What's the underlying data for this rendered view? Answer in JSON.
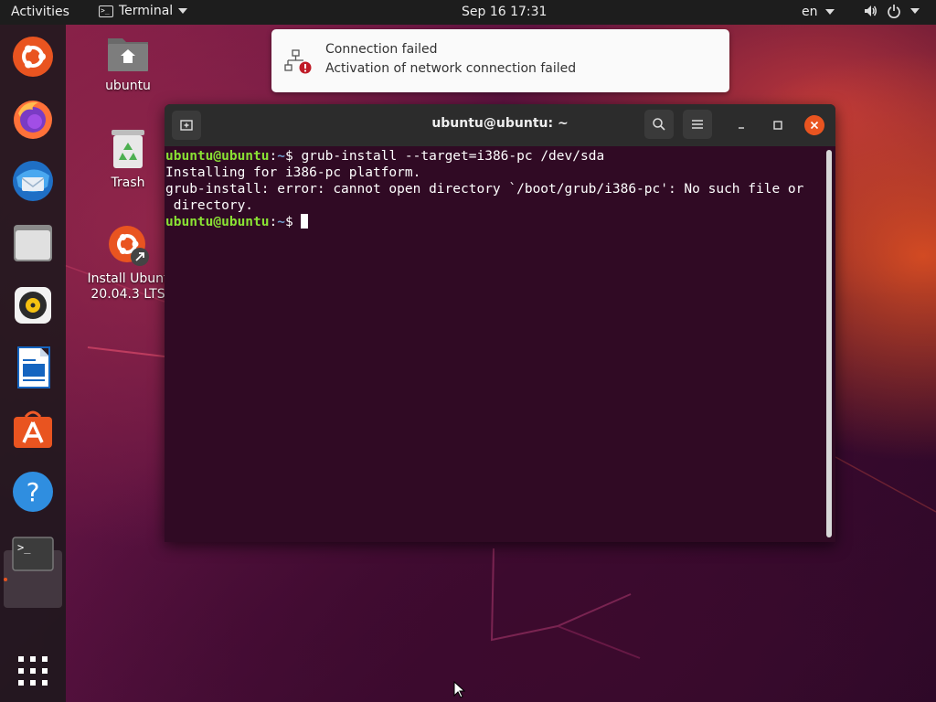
{
  "topbar": {
    "activities": "Activities",
    "app_name": "Terminal",
    "app_icon_glyph": ">_",
    "clock": "Sep 16  17:31",
    "lang": "en",
    "icons": [
      "caret-down-icon",
      "volume-icon",
      "power-icon"
    ]
  },
  "dock": {
    "items": [
      "ubuntu-installer-icon",
      "firefox-icon",
      "thunderbird-icon",
      "files-icon",
      "rhythmbox-icon",
      "libreoffice-writer-icon",
      "ubuntu-software-icon",
      "help-icon",
      "terminal-icon",
      "show-applications-icon"
    ],
    "help_glyph": "?",
    "terminal_glyph": ">_"
  },
  "desktop": {
    "home_label": "ubuntu",
    "trash_label": "Trash",
    "install_label_1": "Install Ubunt",
    "install_label_2": "20.04.3 LTS"
  },
  "notification": {
    "title": "Connection failed",
    "body": "Activation of network connection failed",
    "icons": [
      "network-wired-icon",
      "error-icon"
    ]
  },
  "terminal": {
    "title": "ubuntu@ubuntu: ~",
    "prompt_user": "ubuntu@ubuntu",
    "prompt_colon": ":",
    "prompt_path": "~",
    "prompt_dollar": "$ ",
    "command": "grub-install --target=i386-pc /dev/sda",
    "output_1": "Installing for i386-pc platform.",
    "output_2": "grub-install: error: cannot open directory `/boot/grub/i386-pc': No such file or",
    "output_3": " directory.",
    "header_icons": [
      "new-tab-icon",
      "search-icon",
      "menu-icon",
      "minimize-icon",
      "maximize-icon",
      "close-icon"
    ]
  },
  "colors": {
    "accent": "#e95420",
    "terminal_bg": "#300a24",
    "prompt_user": "#8ae234",
    "prompt_path": "#729fcf"
  }
}
